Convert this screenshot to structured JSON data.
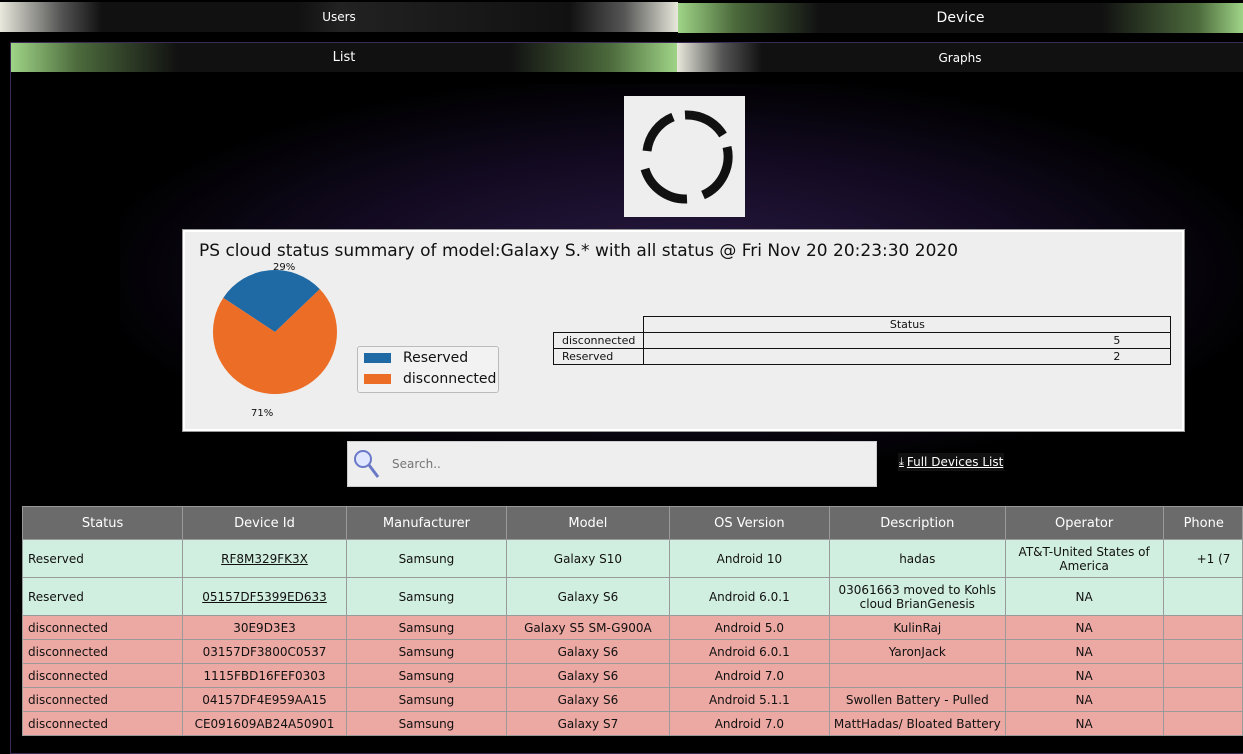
{
  "top_tabs": {
    "users": "Users",
    "device": "Device"
  },
  "sub_tabs": {
    "list": "List",
    "graphs": "Graphs"
  },
  "summary": {
    "title": "PS cloud status summary of model:Galaxy S.* with all status @ Fri Nov 20 20:23:30 2020",
    "pct_reserved": "29%",
    "pct_disconnected": "71%",
    "legend": [
      "Reserved",
      "disconnected"
    ],
    "status_header": "Status",
    "status_rows": [
      {
        "label": "disconnected",
        "value": "5"
      },
      {
        "label": "Reserved",
        "value": "2"
      }
    ]
  },
  "chart_data": {
    "type": "pie",
    "title": "PS cloud status summary of model:Galaxy S.* with all status @ Fri Nov 20 20:23:30 2020",
    "categories": [
      "Reserved",
      "disconnected"
    ],
    "values": [
      2,
      5
    ],
    "percent_labels": [
      "29%",
      "71%"
    ],
    "colors": [
      "#1f6aa5",
      "#ec6d26"
    ],
    "legend_position": "right"
  },
  "search": {
    "placeholder": "Search.."
  },
  "full_list": "Full Devices List",
  "table": {
    "headers": [
      "Status",
      "Device Id",
      "Manufacturer",
      "Model",
      "OS Version",
      "Description",
      "Operator",
      "Phone"
    ],
    "rows": [
      {
        "status": "Reserved",
        "id": "RF8M329FK3X",
        "manufacturer": "Samsung",
        "model": "Galaxy S10",
        "os": "Android 10",
        "desc": "hadas",
        "operator": "AT&T-United States of America",
        "phone": "+1 (7"
      },
      {
        "status": "Reserved",
        "id": "05157DF5399ED633",
        "manufacturer": "Samsung",
        "model": "Galaxy S6",
        "os": "Android 6.0.1",
        "desc": "03061663 moved to Kohls cloud BrianGenesis",
        "operator": "NA",
        "phone": ""
      },
      {
        "status": "disconnected",
        "id": "30E9D3E3",
        "manufacturer": "Samsung",
        "model": "Galaxy S5 SM-G900A",
        "os": "Android 5.0",
        "desc": "KulinRaj",
        "operator": "NA",
        "phone": ""
      },
      {
        "status": "disconnected",
        "id": "03157DF3800C0537",
        "manufacturer": "Samsung",
        "model": "Galaxy S6",
        "os": "Android 6.0.1",
        "desc": "YaronJack",
        "operator": "NA",
        "phone": ""
      },
      {
        "status": "disconnected",
        "id": "1115FBD16FEF0303",
        "manufacturer": "Samsung",
        "model": "Galaxy S6",
        "os": "Android 7.0",
        "desc": "",
        "operator": "NA",
        "phone": ""
      },
      {
        "status": "disconnected",
        "id": "04157DF4E959AA15",
        "manufacturer": "Samsung",
        "model": "Galaxy S6",
        "os": "Android 5.1.1",
        "desc": "Swollen Battery - Pulled",
        "operator": "NA",
        "phone": ""
      },
      {
        "status": "disconnected",
        "id": "CE091609AB24A50901",
        "manufacturer": "Samsung",
        "model": "Galaxy S7",
        "os": "Android 7.0",
        "desc": "MattHadas/ Bloated Battery",
        "operator": "NA",
        "phone": ""
      }
    ]
  }
}
